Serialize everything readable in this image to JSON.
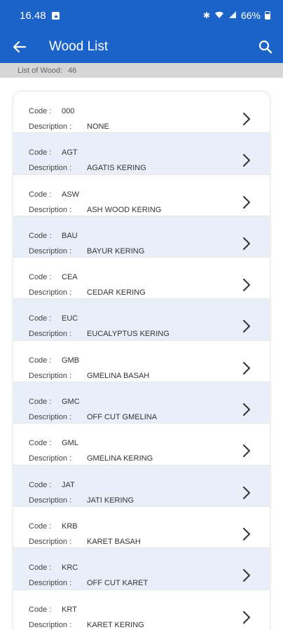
{
  "status": {
    "time": "16.48",
    "battery": "66%"
  },
  "appbar": {
    "title": "Wood List"
  },
  "summary": {
    "label": "List of Wood:",
    "count": "46"
  },
  "labels": {
    "code": "Code :",
    "description": "Description :"
  },
  "colors": {
    "primary": "#1b63c9",
    "row_alt": "#e9eff9"
  },
  "items": [
    {
      "code": "000",
      "description": "NONE"
    },
    {
      "code": "AGT",
      "description": "AGATIS KERING"
    },
    {
      "code": "ASW",
      "description": "ASH WOOD KERING"
    },
    {
      "code": "BAU",
      "description": "BAYUR KERING"
    },
    {
      "code": "CEA",
      "description": "CEDAR KERING"
    },
    {
      "code": "EUC",
      "description": "EUCALYPTUS KERING"
    },
    {
      "code": "GMB",
      "description": "GMELINA BASAH"
    },
    {
      "code": "GMC",
      "description": "OFF CUT GMELINA"
    },
    {
      "code": "GML",
      "description": "GMELINA KERING"
    },
    {
      "code": "JAT",
      "description": "JATI KERING"
    },
    {
      "code": "KRB",
      "description": "KARET BASAH"
    },
    {
      "code": "KRC",
      "description": "OFF CUT KARET"
    },
    {
      "code": "KRT",
      "description": "KARET KERING"
    }
  ]
}
